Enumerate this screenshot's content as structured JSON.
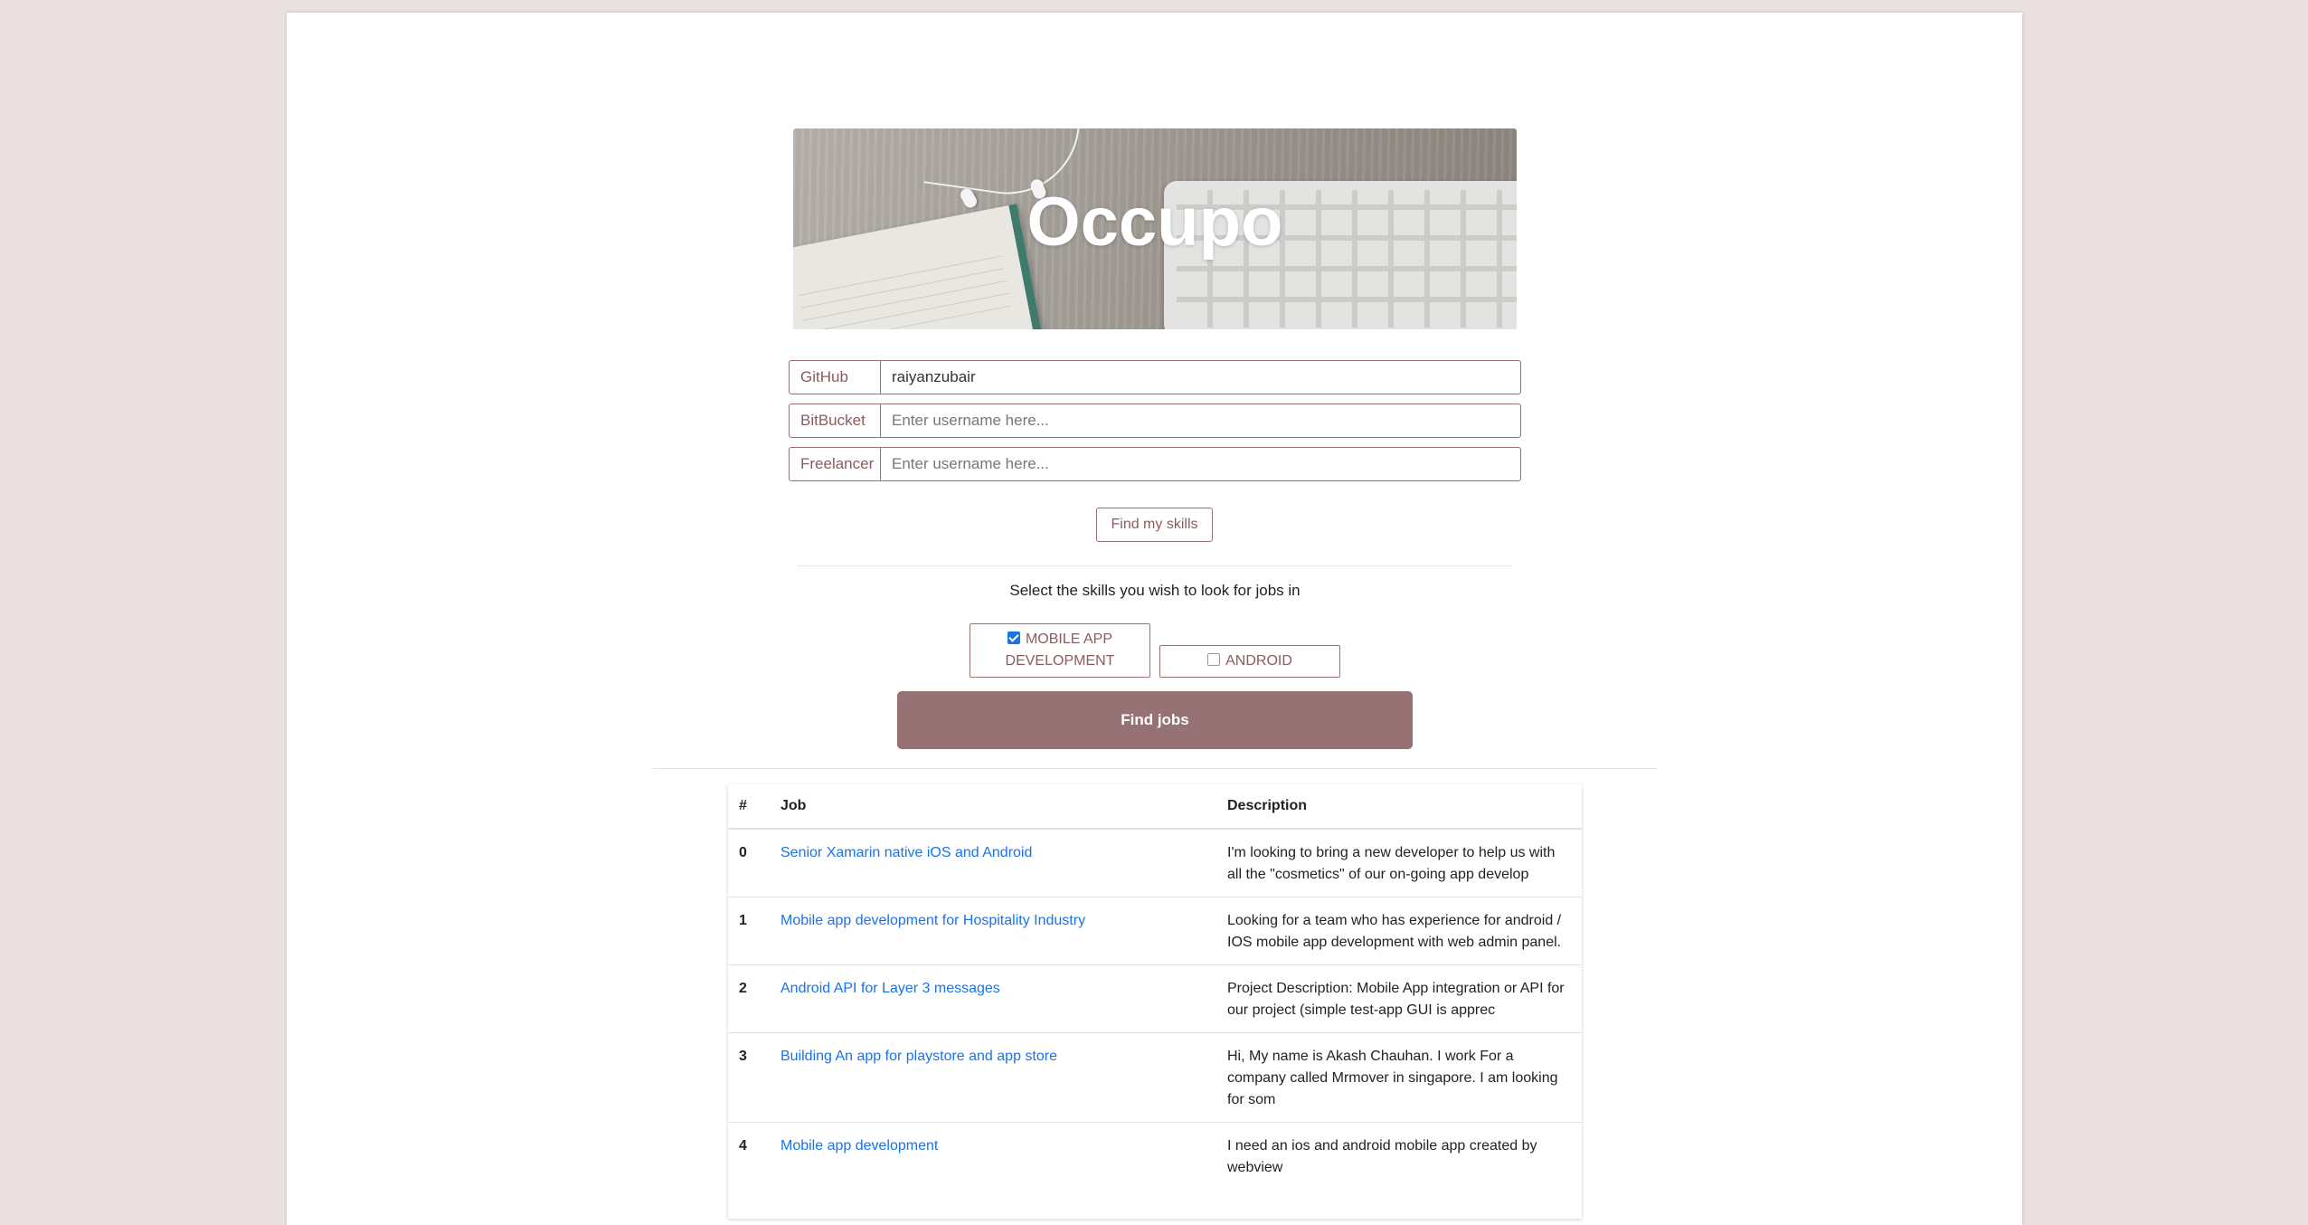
{
  "hero": {
    "title": "Occupo"
  },
  "form": {
    "github": {
      "label": "GitHub",
      "value": "raiyanzubair",
      "placeholder": "Enter username here..."
    },
    "bitbucket": {
      "label": "BitBucket",
      "value": "",
      "placeholder": "Enter username here..."
    },
    "freelancer": {
      "label": "Freelancer",
      "value": "",
      "placeholder": "Enter username here..."
    },
    "find_skills_label": "Find my skills"
  },
  "skills": {
    "prompt": "Select the skills you wish to look for jobs in",
    "items": [
      {
        "label": "MOBILE APP DEVELOPMENT",
        "checked": true
      },
      {
        "label": "ANDROID",
        "checked": false
      }
    ],
    "find_jobs_label": "Find jobs"
  },
  "jobs_table": {
    "headers": [
      "#",
      "Job",
      "Description"
    ],
    "rows": [
      {
        "index": "0",
        "job": "Senior Xamarin native iOS and Android",
        "description": "I'm looking to bring a new developer to help us with all the \"cosmetics\" of our on-going app develop"
      },
      {
        "index": "1",
        "job": "Mobile app development for Hospitality Industry",
        "description": "Looking for a team who has experience for android / IOS mobile app development with web admin panel."
      },
      {
        "index": "2",
        "job": "Android API for Layer 3 messages",
        "description": "Project Description:  Mobile App integration or API for our project (simple test-app GUI is apprec"
      },
      {
        "index": "3",
        "job": "Building An app for playstore and app store",
        "description": "Hi, My name is Akash Chauhan. I work For a company called Mrmover in singapore. I am looking for som"
      },
      {
        "index": "4",
        "job": "Mobile app development",
        "description": "I need an ios and android mobile app created by webview"
      }
    ]
  },
  "colors": {
    "accent": "#967274",
    "border": "#9b7071",
    "link": "#1a73e8",
    "background": "#ebe1e1"
  }
}
